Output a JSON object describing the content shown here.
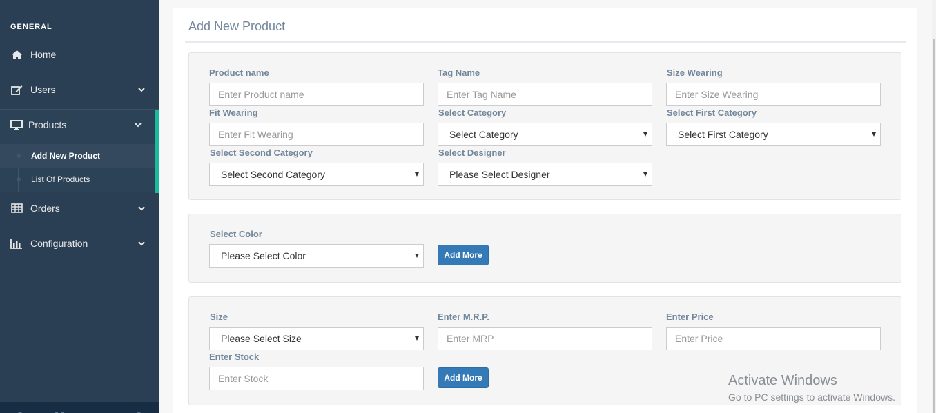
{
  "sidebar": {
    "section_title": "GENERAL",
    "items": [
      {
        "label": "Home",
        "icon": "home-icon"
      },
      {
        "label": "Users",
        "icon": "edit-icon"
      },
      {
        "label": "Products",
        "icon": "desktop-icon"
      },
      {
        "label": "Orders",
        "icon": "table-icon"
      },
      {
        "label": "Configuration",
        "icon": "bar-chart-icon"
      }
    ],
    "products_children": [
      {
        "label": "Add New Product"
      },
      {
        "label": "List Of Products"
      }
    ],
    "footer_icons": [
      "settings-icon",
      "fullscreen-icon",
      "lock-icon",
      "power-icon"
    ],
    "colors": {
      "background": "#2a3f54",
      "accent": "#1abb9c"
    }
  },
  "page": {
    "title": "Add New Product"
  },
  "product_form": {
    "product_name": {
      "label": "Product name",
      "placeholder": "Enter Product name"
    },
    "tag_name": {
      "label": "Tag Name",
      "placeholder": "Enter Tag Name"
    },
    "size_wearing": {
      "label": "Size Wearing",
      "placeholder": "Enter Size Wearing"
    },
    "fit_wearing": {
      "label": "Fit Wearing",
      "placeholder": "Enter Fit Wearing"
    },
    "category": {
      "label": "Select Category",
      "value": "Select Category"
    },
    "first_category": {
      "label": "Select First Category",
      "value": "Select First Category"
    },
    "second_category": {
      "label": "Select Second Category",
      "value": "Select Second Category"
    },
    "designer": {
      "label": "Select Designer",
      "value": "Please Select Designer"
    }
  },
  "color_form": {
    "color": {
      "label": "Select Color",
      "value": "Please Select Color"
    },
    "add_more_label": "Add More"
  },
  "size_form": {
    "size": {
      "label": "Size",
      "value": "Please Select Size"
    },
    "mrp": {
      "label": "Enter M.R.P.",
      "placeholder": "Enter MRP"
    },
    "price": {
      "label": "Enter Price",
      "placeholder": "Enter Price"
    },
    "stock": {
      "label": "Enter Stock",
      "placeholder": "Enter Stock"
    },
    "add_more_label": "Add More"
  },
  "watermark": {
    "line1": "Activate Windows",
    "line2": "Go to PC settings to activate Windows."
  },
  "accent_colors": {
    "primary_button": "#337ab7",
    "active_bar": "#1abb9c"
  }
}
